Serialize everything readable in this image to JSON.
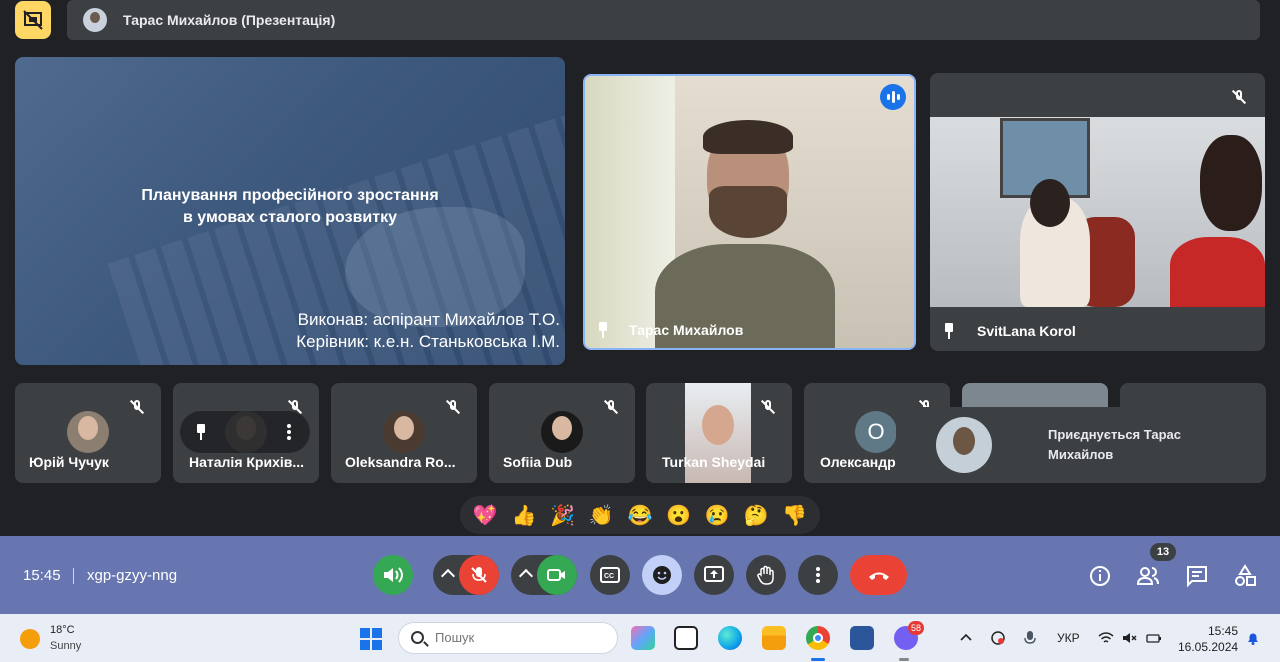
{
  "presenter_bar": {
    "name": "Тарас Михайлов (Презентація)"
  },
  "slide": {
    "title_line1": "Планування професійного зростання",
    "title_line2": "в умовах сталого розвитку",
    "author": "Виконав: аспірант Михайлов Т.О.",
    "supervisor": "Керівник: к.е.н. Станьковська І.М."
  },
  "main_tiles": [
    {
      "name": "Тарас Михайлов"
    },
    {
      "name": "SvitLana Korol"
    }
  ],
  "participants": [
    {
      "name": "Юрій Чучук"
    },
    {
      "name": "Наталія Крихів..."
    },
    {
      "name": "Oleksandra Ro..."
    },
    {
      "name": "Sofiia Dub"
    },
    {
      "name": "Turkan Sheydai"
    },
    {
      "name": "Олександр",
      "initial": "О"
    }
  ],
  "join_toast": {
    "message": "Приєднується Тарас Михайлов"
  },
  "reactions": [
    "💖",
    "👍",
    "🎉",
    "👏",
    "😂",
    "😮",
    "😢",
    "🤔",
    "👎"
  ],
  "control_bar": {
    "time": "15:45",
    "meeting_code": "xgp-gzyy-nng",
    "people_count": "13"
  },
  "taskbar": {
    "weather_temp": "18°C",
    "weather_desc": "Sunny",
    "search_placeholder": "Пошук",
    "viber_badge": "58",
    "language": "УКР",
    "clock_time": "15:45",
    "clock_date": "16.05.2024"
  },
  "colors": {
    "meet_dark": "#202124",
    "tile_bg": "#3c4043",
    "control_bar": "#6776b0",
    "leave_red": "#ea4335",
    "camera_green": "#34a853",
    "speaking_blue": "#1a73e8",
    "present_yellow": "#fdd663"
  }
}
